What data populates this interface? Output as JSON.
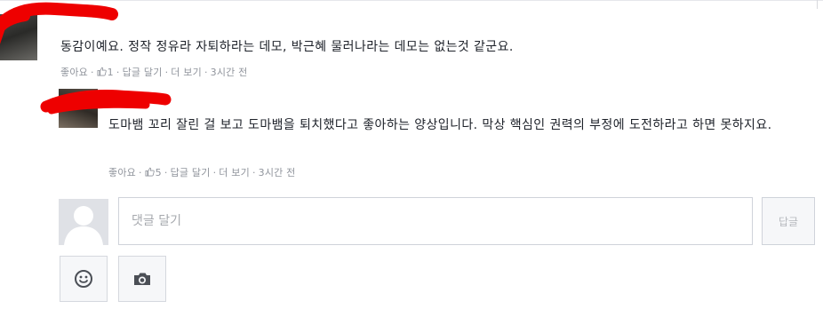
{
  "comment1": {
    "author": "",
    "text": "동감이예요. 정작 정유라 자퇴하라는 데모, 박근혜 물러나라는 데모는 없는것 같군요.",
    "meta": {
      "like": "좋아요",
      "like_count": "1",
      "reply": "답글 달기",
      "more": "더 보기",
      "time": "3시간 전"
    }
  },
  "comment2": {
    "text": "도마뱀 꼬리 잘린 걸 보고 도마뱀을 퇴치했다고 좋아하는 양상입니다. 막상 핵심인 권력의 부정에 도전하라고 하면 못하지요.",
    "meta": {
      "like": "좋아요",
      "like_count": "5",
      "reply": "답글 달기",
      "more": "더 보기",
      "time": "3시간 전"
    }
  },
  "composer": {
    "placeholder": "댓글 달기",
    "value": "",
    "submit_label": "답글"
  },
  "icons": {
    "emoji": "smiley-icon",
    "camera": "camera-icon",
    "like": "thumbs-up-icon",
    "avatar_placeholder": "default-avatar-icon"
  },
  "colors": {
    "link": "#365899",
    "meta": "#90949c",
    "redaction": "#ee0000",
    "border": "#cfd3da"
  }
}
